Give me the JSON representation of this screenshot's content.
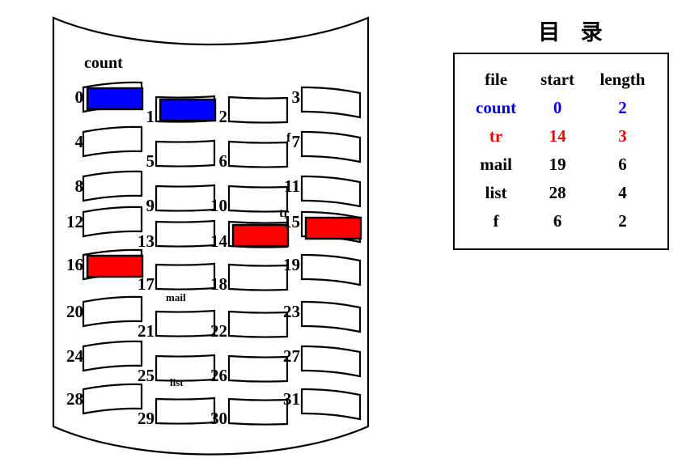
{
  "disk": {
    "name": "disk-block-map",
    "total_blocks": 32,
    "block_numbers": [
      "0",
      "1",
      "2",
      "3",
      "4",
      "5",
      "6",
      "7",
      "8",
      "9",
      "10",
      "11",
      "12",
      "13",
      "14",
      "15",
      "16",
      "17",
      "18",
      "19",
      "20",
      "21",
      "22",
      "23",
      "24",
      "25",
      "26",
      "27",
      "28",
      "29",
      "30",
      "31"
    ],
    "allocated": [
      {
        "block": 0,
        "file": "count",
        "color": "#0000FF"
      },
      {
        "block": 1,
        "file": "count",
        "color": "#0000FF"
      },
      {
        "block": 14,
        "file": "tr",
        "color": "#FF0000"
      },
      {
        "block": 15,
        "file": "tr",
        "color": "#FF0000"
      },
      {
        "block": 16,
        "file": "tr",
        "color": "#FF0000"
      }
    ],
    "file_tags": [
      {
        "label": "count",
        "near_block": 0,
        "size": "big"
      },
      {
        "label": "f",
        "near_block": 7,
        "size": "mid"
      },
      {
        "label": "tr",
        "near_block": 15,
        "size": "mid"
      },
      {
        "label": "mail",
        "near_block": 21,
        "size": "sml"
      },
      {
        "label": "list",
        "near_block": 29,
        "size": "sml"
      }
    ],
    "colors": {
      "outline": "#000000",
      "empty_fill": "#FFFFFF",
      "count_file": "#0000FF",
      "tr_file": "#FF0000"
    }
  },
  "directory": {
    "title": "目 录",
    "columns": [
      "file",
      "start",
      "length"
    ],
    "rows": [
      {
        "file": "count",
        "start": "0",
        "length": "2",
        "color": "#0000FF"
      },
      {
        "file": "tr",
        "start": "14",
        "length": "3",
        "color": "#FF0000"
      },
      {
        "file": "mail",
        "start": "19",
        "length": "6",
        "color": "#000000"
      },
      {
        "file": "list",
        "start": "28",
        "length": "4",
        "color": "#000000"
      },
      {
        "file": "f",
        "start": "6",
        "length": "2",
        "color": "#000000"
      }
    ]
  }
}
